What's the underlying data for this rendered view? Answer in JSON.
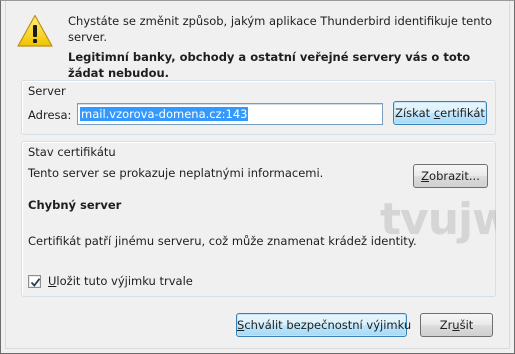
{
  "header": {
    "message": "Chystáte se změnit způsob, jakým aplikace Thunderbird identifikuje tento server.",
    "warning": "Legitimní banky, obchody a ostatní veřejné servery vás o toto žádat nebudou."
  },
  "server": {
    "group_title": "Server",
    "address_label": "Adresa:",
    "address_value": "mail.vzorova-domena.cz:143",
    "get_certificate_button": {
      "before": "Získat ",
      "accel": "c",
      "after": "ertifikát"
    }
  },
  "certificate": {
    "group_title": "Stav certifikátu",
    "status_text": "Tento server se prokazuje neplatnými informacemi.",
    "show_button": {
      "accel": "Z",
      "after": "obrazit..."
    },
    "problem_title": "Chybný server",
    "problem_description": "Certifikát patří jinému serveru, což může znamenat krádež identity.",
    "watermark": "tvujw",
    "permanent_checkbox": {
      "accel": "U",
      "after": "ložit tuto výjimku trvale",
      "checked": true
    }
  },
  "buttons": {
    "confirm": {
      "accel": "S",
      "after": "chválit bezpečnostní výjimku"
    },
    "cancel": {
      "before": "Zr",
      "accel": "u",
      "after": "šit"
    }
  },
  "colors": {
    "selection": "#3399ff",
    "warning_yellow": "#f7d21a",
    "focus_border": "#3c7fb1"
  },
  "icons": {
    "warning": "warning-triangle-icon",
    "checkmark": "checkmark-icon"
  }
}
